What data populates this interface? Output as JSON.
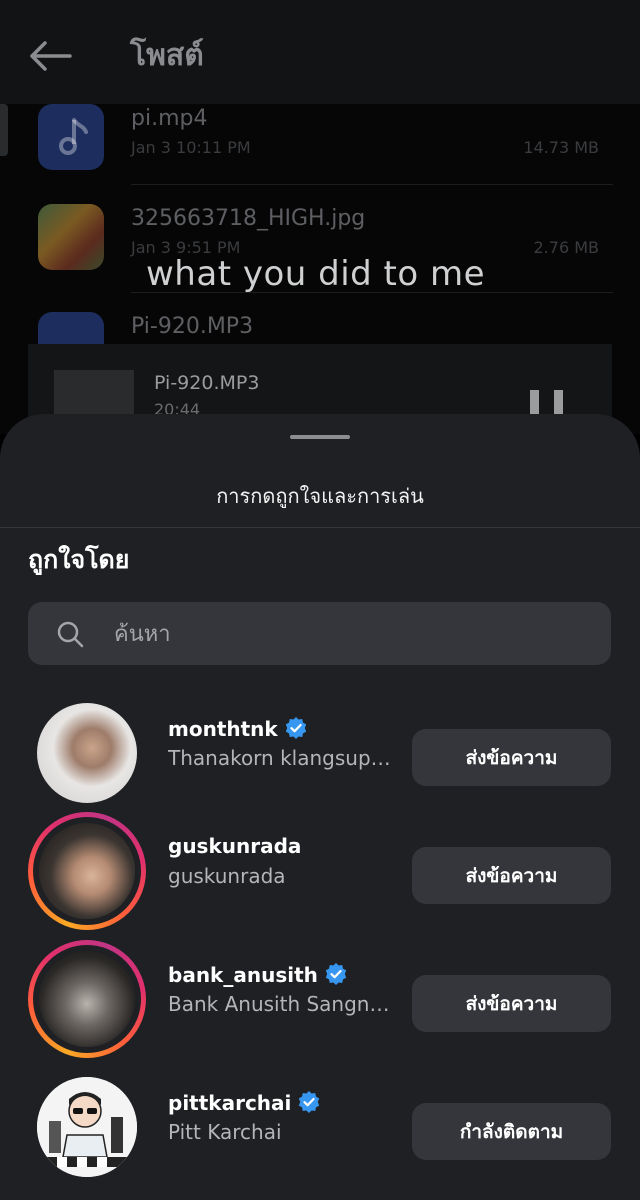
{
  "header": {
    "title": "โพสต์"
  },
  "files": [
    {
      "name": "pi.mp4",
      "date": "Jan 3 10:11 PM",
      "size": "14.73 MB",
      "icon": "music-note-icon"
    },
    {
      "name": "325663718_HIGH.jpg",
      "date": "Jan 3 9:51 PM",
      "size": "2.76 MB",
      "icon": "image-thumbnail"
    },
    {
      "name": "Pi-920.MP3",
      "date": "",
      "size": "",
      "icon": "music-note-icon"
    }
  ],
  "lyric_overlay": "what you did to me",
  "player": {
    "title": "Pi-920.MP3",
    "time": "20:44"
  },
  "sheet": {
    "title": "การกดถูกใจและการเล่น",
    "section_title": "ถูกใจโดย",
    "search": {
      "placeholder": "ค้นหา",
      "value": ""
    },
    "users": [
      {
        "username": "monthtnk",
        "fullname": "Thanakorn klangsupap",
        "verified": true,
        "story_ring": false,
        "button": "ส่งข้อความ"
      },
      {
        "username": "guskunrada",
        "fullname": "guskunrada",
        "verified": false,
        "story_ring": true,
        "button": "ส่งข้อความ"
      },
      {
        "username": "bank_anusith",
        "fullname": "Bank Anusith Sangnimnuan",
        "verified": true,
        "story_ring": true,
        "button": "ส่งข้อความ"
      },
      {
        "username": "pittkarchai",
        "fullname": "Pitt Karchai",
        "verified": true,
        "story_ring": false,
        "button": "กำลังติดตาม"
      }
    ]
  },
  "colors": {
    "sheet_bg": "#1e2024",
    "button_bg": "#34363b",
    "verified_blue": "#3797f0",
    "secondary_text": "#b3b5b8"
  }
}
